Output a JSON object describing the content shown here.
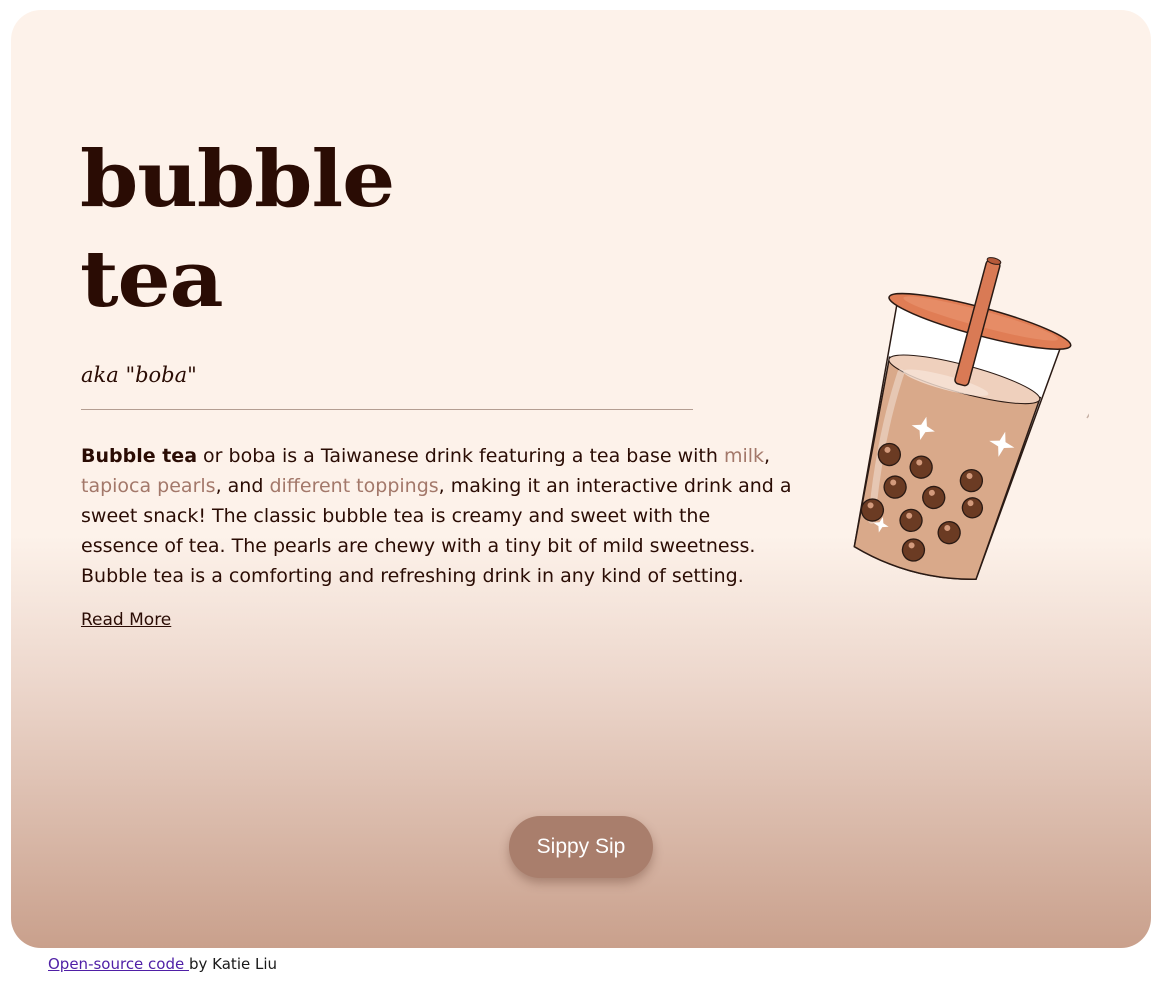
{
  "hero": {
    "title_line1": "bubble",
    "title_line2": "tea",
    "aka": "aka \"boba\""
  },
  "description": {
    "bold": "Bubble tea",
    "part1": " or boba is a Taiwanese drink featuring a tea base with ",
    "link_milk": "milk",
    "sep1": ", ",
    "link_pearls": "tapioca pearls",
    "sep2": ", and ",
    "link_toppings": "different toppings",
    "part2": ", making it an interactive drink and a sweet snack! The classic bubble tea is creamy and sweet with the essence of tea. The pearls are chewy with a tiny bit of mild sweetness. Bubble tea is a comforting and refreshing drink in any kind of setting."
  },
  "read_more": "Read More",
  "button": {
    "label": "Sippy Sip"
  },
  "footer": {
    "link": "Open-source code ",
    "text": "by Katie Liu"
  },
  "colors": {
    "text_dark": "#2a0c04",
    "link_tan": "#a3786a",
    "button_bg": "#a97e6c",
    "card_top": "#fdf2ea",
    "card_bottom": "#c9a08c"
  },
  "icons": [
    "bubble-tea-cup-icon"
  ]
}
